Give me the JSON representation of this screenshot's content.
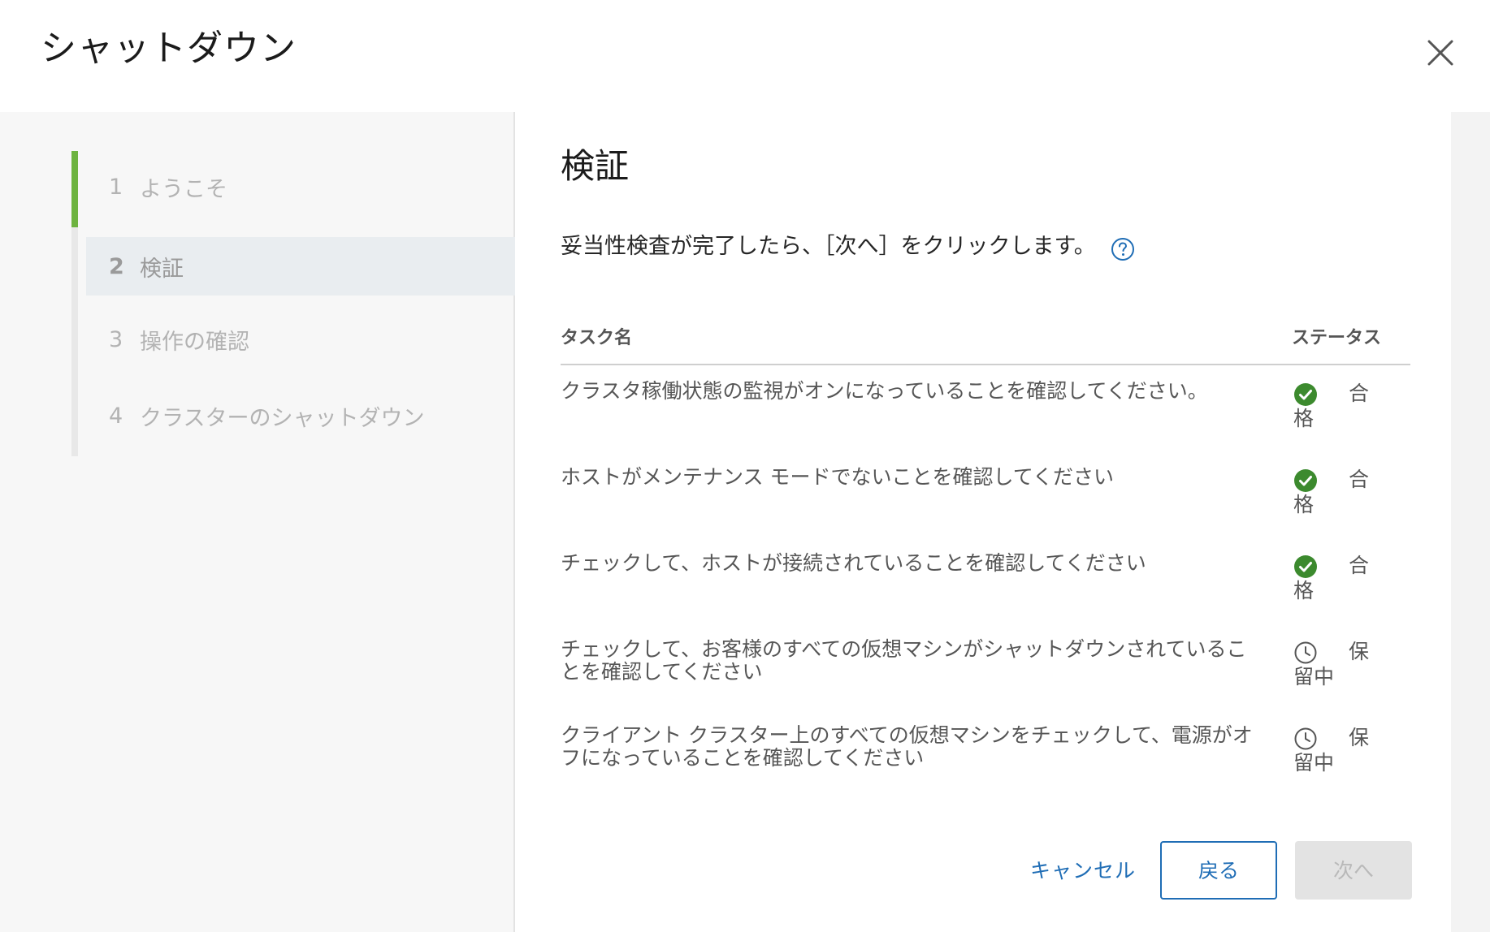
{
  "dialog": {
    "title": "シャットダウン",
    "close_icon": "close-icon"
  },
  "steps": [
    {
      "num": "1",
      "label": "ようこそ",
      "state": "completed"
    },
    {
      "num": "2",
      "label": "検証",
      "state": "active"
    },
    {
      "num": "3",
      "label": "操作の確認",
      "state": "pending"
    },
    {
      "num": "4",
      "label": "クラスターのシャットダウン",
      "state": "pending"
    }
  ],
  "main": {
    "title": "検証",
    "instruction": "妥当性検査が完了したら、［次へ］をクリックします。",
    "help_icon": "help-circle-icon"
  },
  "table": {
    "columns": {
      "task": "タスク名",
      "status": "ステータス"
    },
    "rows": [
      {
        "task": "クラスタ稼働状態の監視がオンになっていることを確認してください。",
        "status": "合格",
        "status_icon": "check-circle-icon"
      },
      {
        "task": "ホストがメンテナンス モードでないことを確認してください",
        "status": "合格",
        "status_icon": "check-circle-icon"
      },
      {
        "task": "チェックして、ホストが接続されていることを確認してください",
        "status": "合格",
        "status_icon": "check-circle-icon"
      },
      {
        "task": "チェックして、お客様のすべての仮想マシンがシャットダウンされていることを確認してください",
        "status": "保留中",
        "status_icon": "clock-icon"
      },
      {
        "task": "クライアント クラスター上のすべての仮想マシンをチェックして、電源がオフになっていることを確認してください",
        "status": "保留中",
        "status_icon": "clock-icon"
      }
    ]
  },
  "footer": {
    "cancel_label": "キャンセル",
    "back_label": "戻る",
    "next_label": "次へ",
    "next_enabled": false
  },
  "colors": {
    "accent_blue": "#1f6db5",
    "step_progress_green": "#6db33f",
    "pass_green": "#3c8a2e"
  }
}
